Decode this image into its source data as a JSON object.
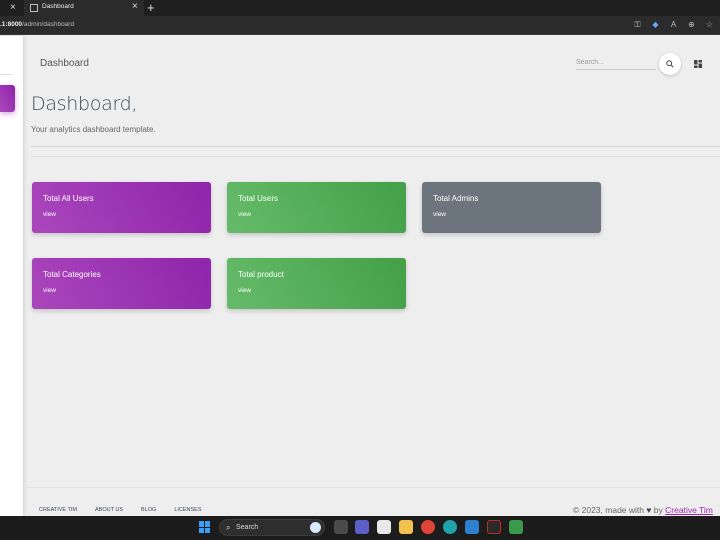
{
  "browser": {
    "tab_title": "Dashboard",
    "url_host": ".1:8000",
    "url_path": "/admin/dashboard",
    "tab_close": "×",
    "new_tab": "+"
  },
  "header": {
    "nav_title": "Dashboard",
    "search_placeholder": "Search..."
  },
  "page": {
    "title": "Dashboard,",
    "subtitle": "Your analytics dashboard template."
  },
  "cards": [
    {
      "title": "Total All Users",
      "link": "view",
      "color": "#9c27b0"
    },
    {
      "title": "Total Users",
      "link": "view",
      "color": "#4caf50"
    },
    {
      "title": "Total Admins",
      "link": "view",
      "color": "#6c757d"
    },
    {
      "title": "Total Categories",
      "link": "view",
      "color": "#9c27b0"
    },
    {
      "title": "Total product",
      "link": "view",
      "color": "#4caf50"
    }
  ],
  "footer": {
    "links": [
      "CREATIVE TIM",
      "ABOUT US",
      "BLOG",
      "LICENSES"
    ],
    "copyright_prefix": "© 2023, made with",
    "copyright_by": "by",
    "copyright_brand": "Creative Tim"
  },
  "taskbar": {
    "search_label": "Search"
  },
  "colors": {
    "purple": "#9c27b0",
    "green": "#4caf50",
    "gray": "#6c757d"
  }
}
